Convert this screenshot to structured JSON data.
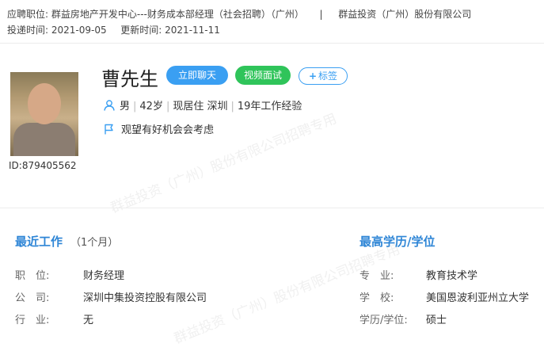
{
  "header": {
    "position_label": "应聘职位:",
    "position_value": "群益房地产开发中心---财务成本部经理（社会招聘）（广州）",
    "separator": "|",
    "company": "群益投资（广州）股份有限公司",
    "submit_label": "投递时间:",
    "submit_date": "2021-09-05",
    "update_label": "更新时间:",
    "update_date": "2021-11-11"
  },
  "watermark": {
    "line1": "群益投资（广州）股份有限公司招聘专用",
    "line2": "群益投资（广州）股份有限公司招聘专用"
  },
  "profile": {
    "id_text": "ID:879405562",
    "name": "曹先生",
    "chat_button": "立即聊天",
    "video_button": "视频面试",
    "tag_button": "标签",
    "tag_plus": "+",
    "gender": "男",
    "age": "42岁",
    "residence": "现居住 深圳",
    "experience": "19年工作经验",
    "sep": "|",
    "job_status": "观望有好机会会考虑"
  },
  "recent_work": {
    "title": "最近工作",
    "duration": "（1个月）",
    "rows": [
      {
        "label": "职　位:",
        "value": "财务经理"
      },
      {
        "label": "公　司:",
        "value": "深圳中集投资控股有限公司"
      },
      {
        "label": "行　业:",
        "value": "无"
      }
    ]
  },
  "education": {
    "title": "最高学历/学位",
    "rows": [
      {
        "label": "专　业:",
        "value": "教育技术学"
      },
      {
        "label": "学　校:",
        "value": "美国恩波利亚州立大学"
      },
      {
        "label": "学历/学位:",
        "value": "硕士"
      }
    ]
  },
  "colors": {
    "accent_blue": "#3a9ff2",
    "accent_green": "#2fc45a",
    "section_title": "#2f86d6"
  }
}
